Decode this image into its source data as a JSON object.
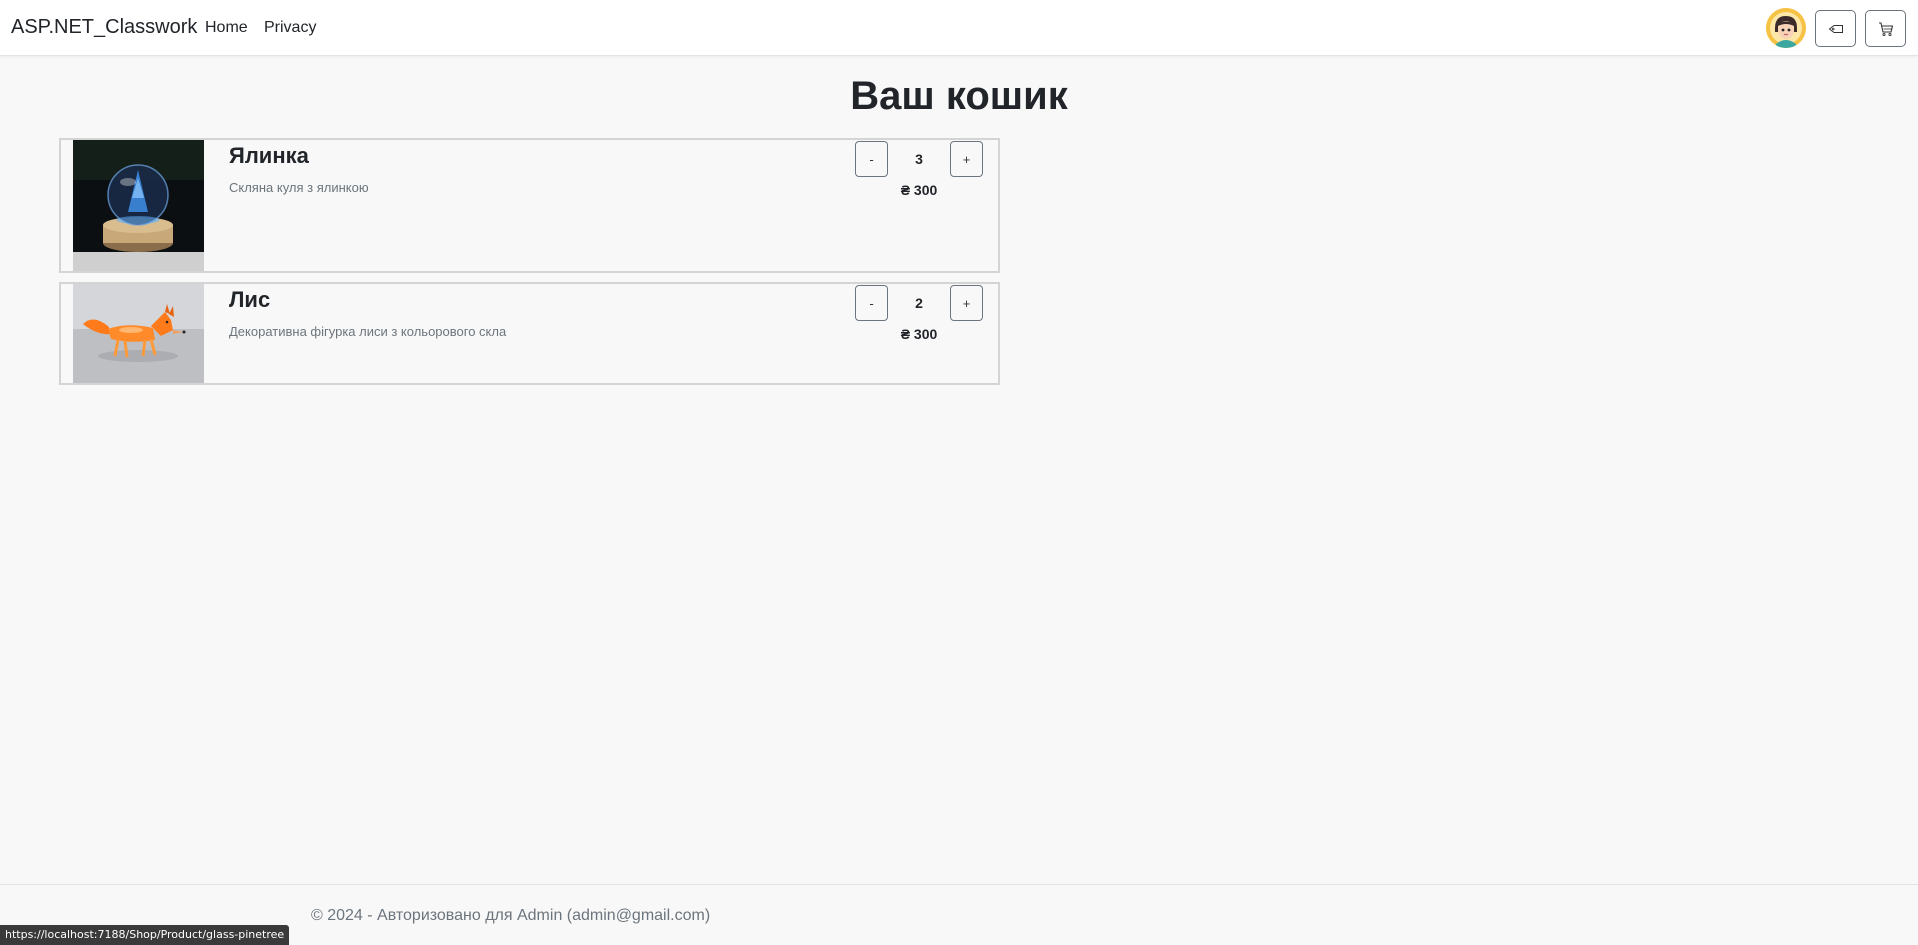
{
  "navbar": {
    "brand": "ASP.NET_Classwork",
    "links": [
      {
        "label": "Home"
      },
      {
        "label": "Privacy"
      }
    ],
    "icons": {
      "avatar": "user-avatar",
      "tag": "tag-icon",
      "cart": "cart-icon"
    }
  },
  "main": {
    "title": "Ваш кошик",
    "items": [
      {
        "name": "Ялинка",
        "description": "Скляна куля з ялинкою",
        "minus": "-",
        "quantity": "3",
        "plus": "+",
        "price": "₴ 300"
      },
      {
        "name": "Лис",
        "description": "Декоративна фігурка лиси з кольорового скла",
        "minus": "-",
        "quantity": "2",
        "plus": "+",
        "price": "₴ 300"
      }
    ]
  },
  "footer": {
    "text": "© 2024 - Авторизовано для Admin (admin@gmail.com)"
  },
  "status_bar": {
    "url": "https://localhost:7188/Shop/Product/glass-pinetree"
  },
  "colors": {
    "background": "#f8f8f8",
    "text": "#212529",
    "muted": "#6c757d",
    "border": "#d4d4d4",
    "avatar_bg": "#f6c244"
  }
}
